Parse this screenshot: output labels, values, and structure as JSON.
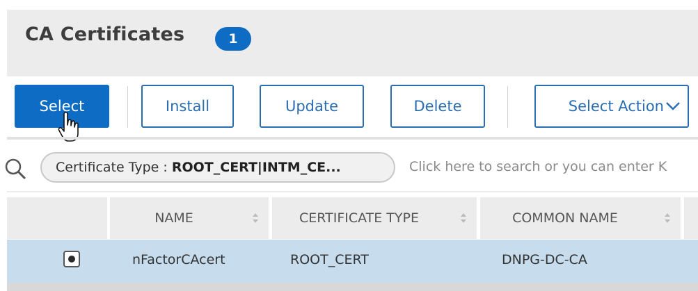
{
  "header": {
    "title": "CA Certificates",
    "count": "1"
  },
  "toolbar": {
    "select_label": "Select",
    "install_label": "Install",
    "update_label": "Update",
    "delete_label": "Delete",
    "actions_label": "Select Action"
  },
  "search": {
    "filter_key": "Certificate Type : ",
    "filter_value": "ROOT_CERT|INTM_CE...",
    "hint": "Click here to search or you can enter K"
  },
  "table": {
    "columns": [
      "NAME",
      "CERTIFICATE TYPE",
      "COMMON NAME"
    ],
    "rows": [
      {
        "selected": true,
        "name": "nFactorCAcert",
        "type": "ROOT_CERT",
        "common_name": "DNPG-DC-CA"
      }
    ]
  },
  "colors": {
    "accent": "#0e6cc4",
    "selected_row": "#c7dcec",
    "header_bg": "#ececec"
  },
  "icons": [
    "search-icon",
    "sort-icon",
    "chevron-down-icon",
    "hand-cursor-icon",
    "radio-icon"
  ]
}
